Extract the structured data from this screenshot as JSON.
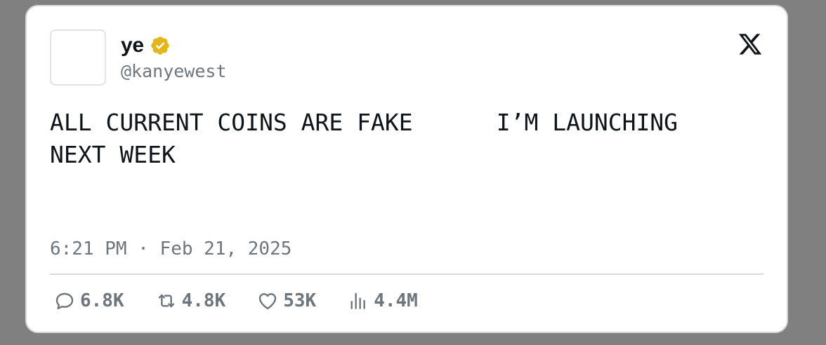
{
  "tweet": {
    "display_name": "ye",
    "handle": "@kanyewest",
    "text": "ALL CURRENT COINS ARE FAKE      I’M LAUNCHING\nNEXT WEEK",
    "time": "6:21 PM",
    "separator": "·",
    "date": "Feb 21, 2025"
  },
  "stats": {
    "replies": "6.8K",
    "reposts": "4.8K",
    "likes": "53K",
    "views": "4.4M"
  },
  "icons": {
    "verified": "verified-badge-icon",
    "logo": "x-logo-icon",
    "reply": "reply-icon",
    "repost": "repost-icon",
    "like": "heart-icon",
    "views": "views-icon"
  },
  "colors": {
    "background": "#808080",
    "card": "#ffffff",
    "text": "#0f1419",
    "muted": "#6e767d",
    "verified_gold": "#e2b719"
  }
}
